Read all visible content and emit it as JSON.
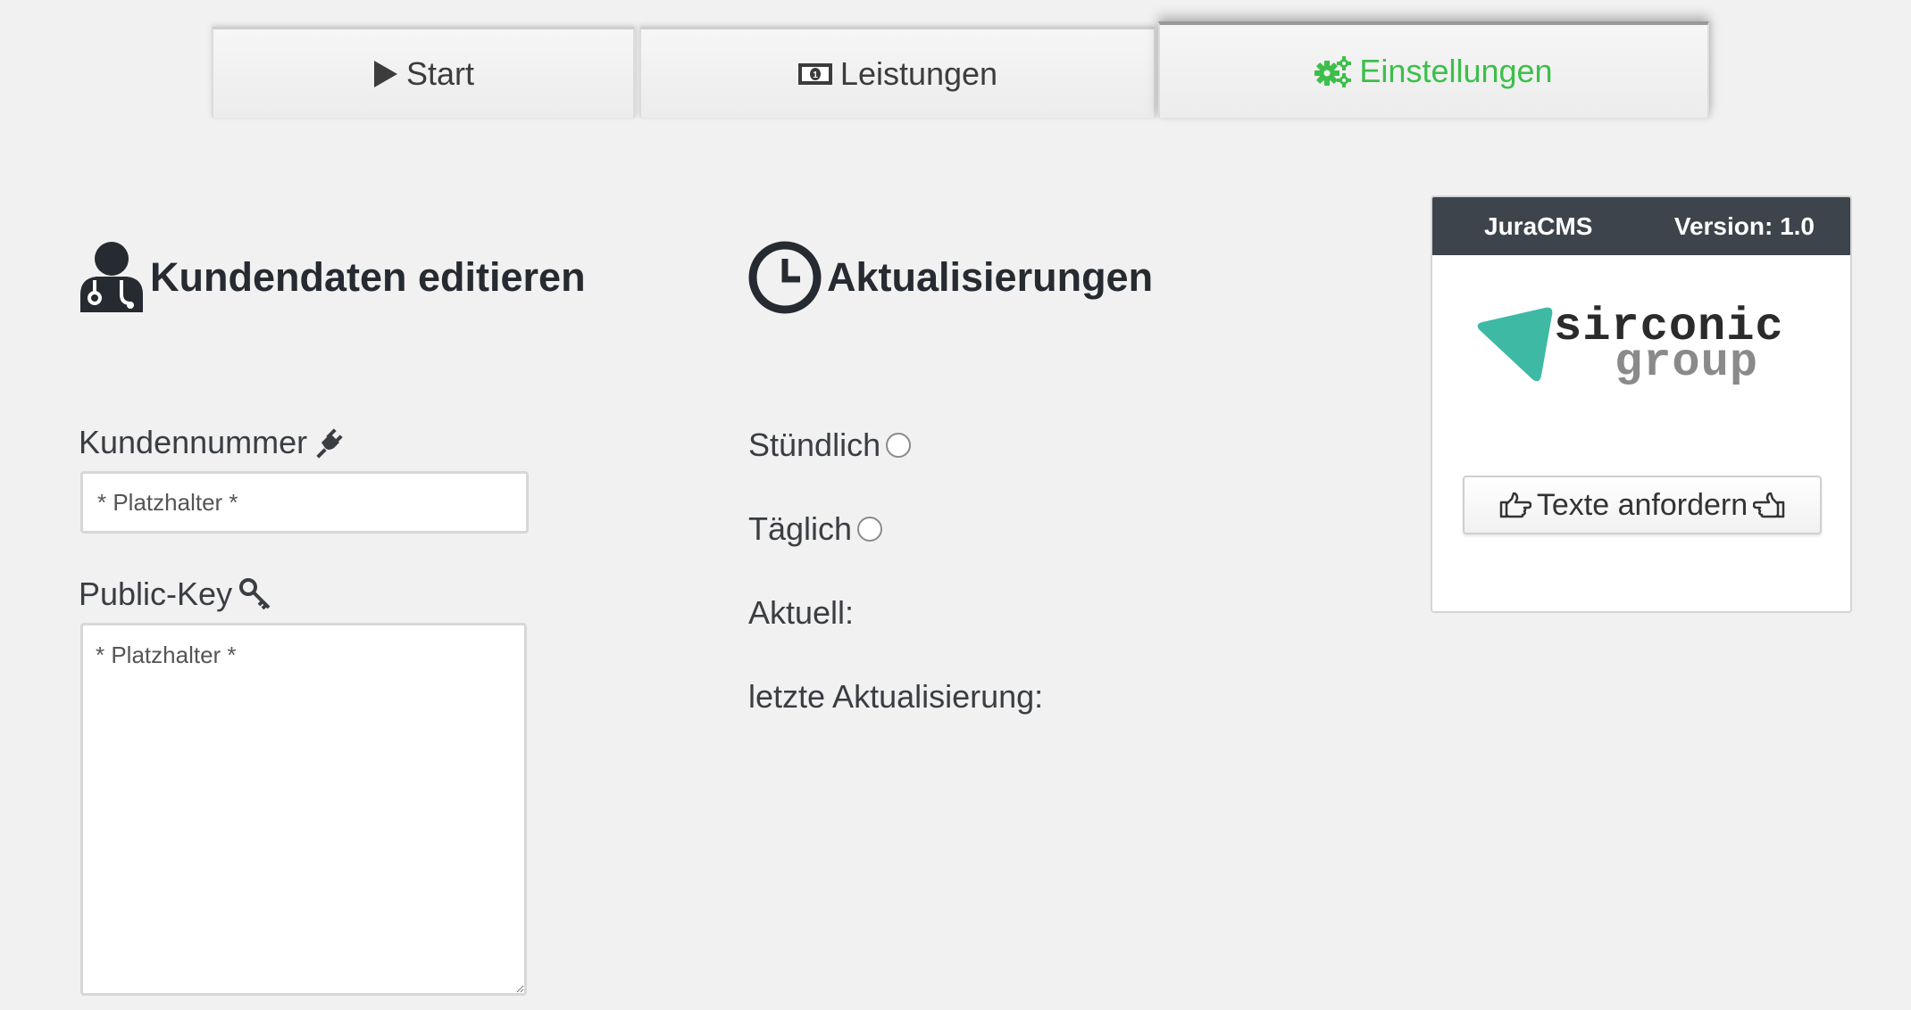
{
  "tabs": [
    {
      "label": "Start",
      "icon": "play-icon"
    },
    {
      "label": "Leistungen",
      "icon": "money-icon"
    },
    {
      "label": "Einstellungen",
      "icon": "gears-icon",
      "active": true
    }
  ],
  "colors": {
    "active_tab": "#3cbf4a",
    "panel_header": "#3d444b",
    "logo_triangle": "#3eb9a4"
  },
  "kundendaten": {
    "title": "Kundendaten editieren",
    "icon": "user-doctor-icon",
    "kundennummer_label": "Kundennummer",
    "kundennummer_icon": "plug-icon",
    "kundennummer_placeholder": "* Platzhalter *",
    "publickey_label": "Public-Key",
    "publickey_icon": "key-icon",
    "publickey_placeholder": "* Platzhalter *"
  },
  "aktualisierungen": {
    "title": "Aktualisierungen",
    "icon": "clock-icon",
    "stuendlich": "Stündlich",
    "taeglich": "Täglich",
    "aktuell": "Aktuell:",
    "letzte": "letzte Aktualisierung:"
  },
  "panel": {
    "app_name": "JuraCMS",
    "version": "Version: 1.0",
    "logo_line1": "sirconic",
    "logo_line2": "group",
    "button_label": "Texte anfordern"
  }
}
